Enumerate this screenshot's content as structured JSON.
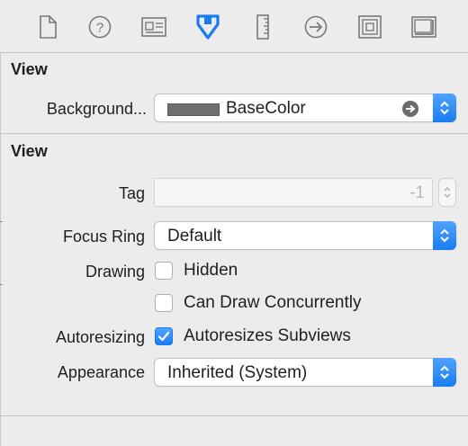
{
  "toolbar": {
    "tabs": [
      {
        "icon": "file-icon"
      },
      {
        "icon": "help-icon"
      },
      {
        "icon": "identity-icon"
      },
      {
        "icon": "attributes-icon",
        "selected": true
      },
      {
        "icon": "size-ruler-icon"
      },
      {
        "icon": "connections-icon"
      },
      {
        "icon": "bindings-icon"
      },
      {
        "icon": "view-effects-icon"
      }
    ],
    "accent_color": "#1a7cf2"
  },
  "section1": {
    "title": "View",
    "background_label": "Background...",
    "background_value": "BaseColor",
    "background_swatch": "#6e6e6e"
  },
  "section2": {
    "title": "View",
    "tag_label": "Tag",
    "tag_value": "-1",
    "focus_ring_label": "Focus Ring",
    "focus_ring_value": "Default",
    "drawing_label": "Drawing",
    "hidden_label": "Hidden",
    "hidden_checked": false,
    "concurrent_label": "Can Draw Concurrently",
    "concurrent_checked": false,
    "autoresizing_label": "Autoresizing",
    "autoresizes_label": "Autoresizes Subviews",
    "autoresizes_checked": true,
    "appearance_label": "Appearance",
    "appearance_value": "Inherited (System)"
  }
}
